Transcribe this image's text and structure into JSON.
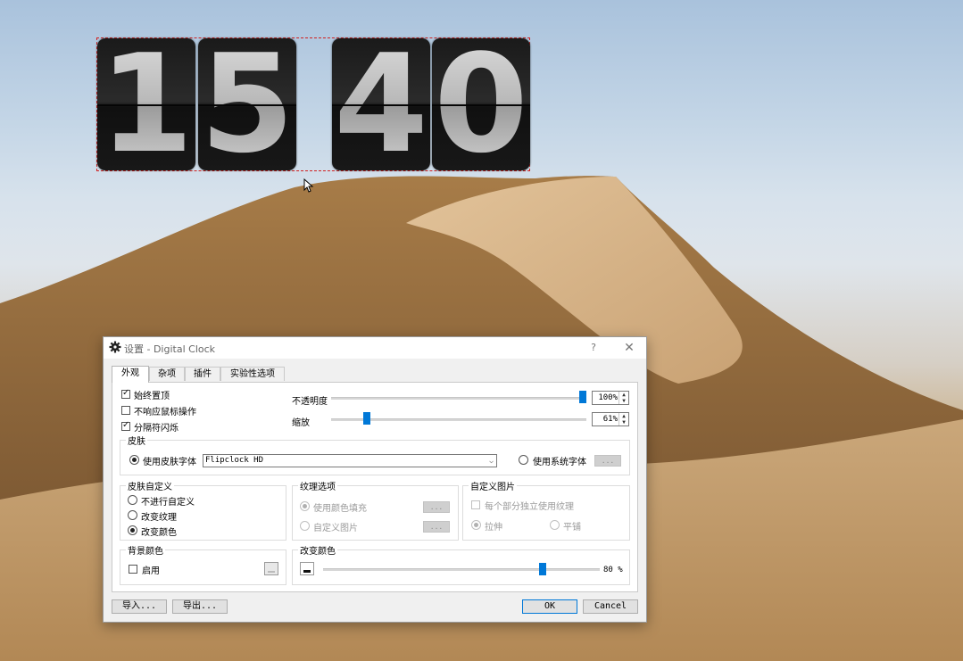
{
  "clock": {
    "digits": [
      "1",
      "5",
      "4",
      "0"
    ]
  },
  "dialog": {
    "title": "设置 - Digital Clock",
    "help": "?",
    "close": "✕",
    "tabs": [
      "外观",
      "杂项",
      "插件",
      "实验性选项"
    ],
    "appearance": {
      "always_on_top": "始终置顶",
      "ignore_mouse": "不响应鼠标操作",
      "separator_blink": "分隔符闪烁",
      "opacity_label": "不透明度",
      "opacity_value": "100%",
      "opacity_fraction": 1.0,
      "zoom_label": "缩放",
      "zoom_value": "61%",
      "zoom_fraction": 0.13
    },
    "skin": {
      "group_title": "皮肤",
      "use_skin_font": "使用皮肤字体",
      "skin_selected": "Flipclock HD",
      "use_system_font": "使用系统字体",
      "font_button": "..."
    },
    "customize": {
      "group_title": "皮肤自定义",
      "no_custom": "不进行自定义",
      "change_texture": "改变纹理",
      "change_color": "改变颜色"
    },
    "texture": {
      "group_title": "纹理选项",
      "fill_color": "使用颜色填充",
      "custom_image": "自定义图片",
      "btn1": "...",
      "btn2": "..."
    },
    "custom_image": {
      "group_title": "自定义图片",
      "per_part": "每个部分独立使用纹理",
      "stretch": "拉伸",
      "tile": "平铺"
    },
    "background": {
      "group_title": "背景颜色",
      "enable": "启用"
    },
    "change_color": {
      "group_title": "改变颜色",
      "value": "80 %",
      "fraction": 0.8
    },
    "buttons": {
      "import": "导入...",
      "export": "导出...",
      "ok": "OK",
      "cancel": "Cancel"
    }
  }
}
